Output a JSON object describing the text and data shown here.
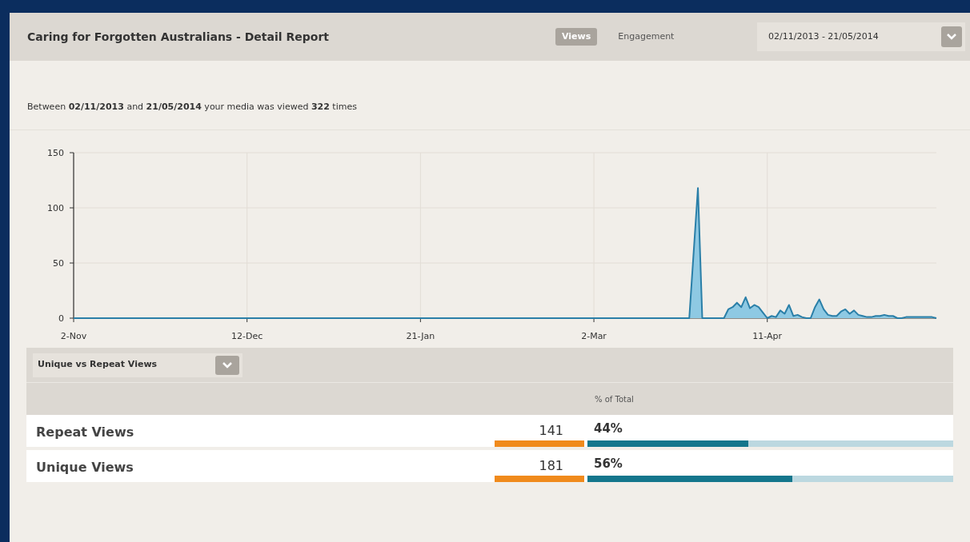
{
  "header": {
    "title": "Caring for Forgotten Australians - Detail Report",
    "tabs": [
      {
        "label": "Views",
        "selected": true
      },
      {
        "label": "Engagement",
        "selected": false
      }
    ],
    "date_range": {
      "value": "02/11/2013 - 21/05/2014"
    }
  },
  "summary": "Between **02/11/2013** and **21/05/2014** your media was viewed **322** times",
  "chart": {
    "chart_data": {
      "type": "area",
      "categories": [
        "2-Nov",
        null,
        null,
        null,
        null,
        null,
        null,
        null,
        null,
        null,
        null,
        null,
        null,
        null,
        null,
        null,
        null,
        null,
        null,
        null,
        null,
        null,
        null,
        null,
        null,
        null,
        null,
        null,
        null,
        null,
        null,
        null,
        null,
        null,
        null,
        null,
        null,
        null,
        null,
        null,
        "12-Dec",
        null,
        null,
        null,
        null,
        null,
        null,
        null,
        null,
        null,
        null,
        null,
        null,
        null,
        null,
        null,
        null,
        null,
        null,
        null,
        null,
        null,
        null,
        null,
        null,
        null,
        null,
        null,
        null,
        null,
        null,
        null,
        null,
        null,
        null,
        null,
        null,
        null,
        null,
        null,
        "21-Jan",
        null,
        null,
        null,
        null,
        null,
        null,
        null,
        null,
        null,
        null,
        null,
        null,
        null,
        null,
        null,
        null,
        null,
        null,
        null,
        null,
        null,
        null,
        null,
        null,
        null,
        null,
        null,
        null,
        null,
        null,
        null,
        null,
        null,
        null,
        null,
        null,
        null,
        null,
        null,
        "2-Mar",
        null,
        null,
        null,
        null,
        null,
        null,
        null,
        null,
        null,
        null,
        null,
        null,
        null,
        null,
        null,
        null,
        null,
        null,
        null,
        null,
        null,
        null,
        null,
        null,
        null,
        null,
        null,
        null,
        null,
        null,
        null,
        null,
        null,
        null,
        null,
        null,
        null,
        null,
        null,
        "11-Apr",
        null,
        null,
        null,
        null,
        null,
        null,
        null,
        null,
        null,
        null,
        null,
        null,
        null,
        null,
        null,
        null,
        null,
        null,
        null,
        null,
        null,
        null,
        null,
        null,
        null,
        null,
        null,
        null,
        null,
        null,
        null,
        null,
        null,
        null,
        null,
        null,
        null,
        null,
        null
      ],
      "series": [
        {
          "color": "#2a7fa8",
          "values": [
            0,
            0,
            0,
            0,
            0,
            0,
            0,
            0,
            0,
            0,
            0,
            0,
            0,
            0,
            0,
            0,
            0,
            0,
            0,
            0,
            0,
            0,
            0,
            0,
            0,
            0,
            0,
            0,
            0,
            0,
            0,
            0,
            0,
            0,
            0,
            0,
            0,
            0,
            0,
            0,
            0,
            0,
            0,
            0,
            0,
            0,
            0,
            0,
            0,
            0,
            0,
            0,
            0,
            0,
            0,
            0,
            0,
            0,
            0,
            0,
            0,
            0,
            0,
            0,
            0,
            0,
            0,
            0,
            0,
            0,
            0,
            0,
            0,
            0,
            0,
            0,
            0,
            0,
            0,
            0,
            0,
            0,
            0,
            0,
            0,
            0,
            0,
            0,
            0,
            0,
            0,
            0,
            0,
            0,
            0,
            0,
            0,
            0,
            0,
            0,
            0,
            0,
            0,
            0,
            0,
            0,
            0,
            0,
            0,
            0,
            0,
            0,
            0,
            0,
            0,
            0,
            0,
            0,
            0,
            0,
            0,
            0,
            0,
            0,
            0,
            0,
            0,
            0,
            0,
            0,
            0,
            0,
            0,
            0,
            0,
            0,
            0,
            0,
            0,
            0,
            0,
            0,
            0,
            59,
            118,
            0,
            0,
            0,
            0,
            0,
            0,
            8,
            10,
            14,
            10,
            19,
            9,
            12,
            10,
            5,
            0,
            2,
            1,
            7,
            4,
            12,
            2,
            3,
            1,
            0,
            0,
            10,
            17,
            8,
            3,
            2,
            2,
            6,
            8,
            4,
            7,
            3,
            2,
            1,
            1,
            2,
            2,
            3,
            2,
            2,
            0,
            0,
            1,
            1,
            1,
            1,
            1,
            1,
            1,
            0
          ]
        }
      ],
      "ylim": [
        0,
        150
      ],
      "yticks": [
        0,
        50,
        100,
        150
      ]
    }
  },
  "breakdown": {
    "selector": {
      "value": "Unique vs Repeat Views"
    },
    "column_header": "% of Total",
    "rows": [
      {
        "label": "Repeat Views",
        "count": "141",
        "percent": "44%",
        "level": 0.44
      },
      {
        "label": "Unique Views",
        "count": "181",
        "percent": "56%",
        "level": 0.56
      }
    ]
  }
}
